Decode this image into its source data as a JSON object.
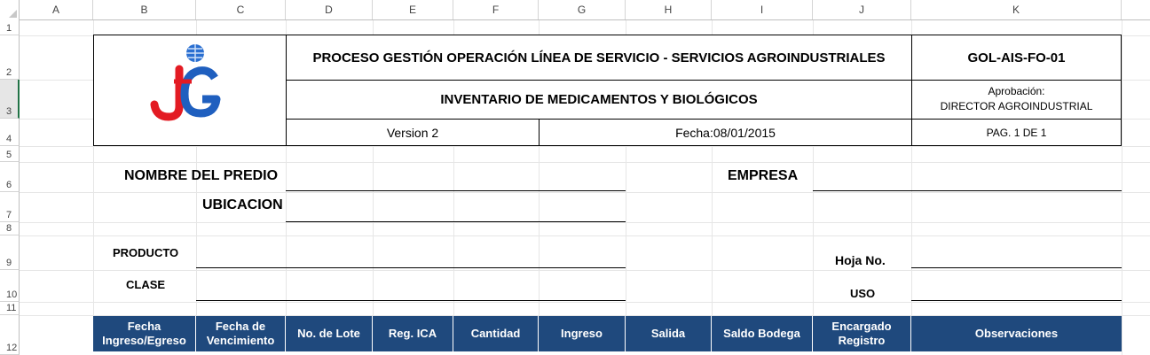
{
  "sheet": {
    "columns": [
      "A",
      "B",
      "C",
      "D",
      "E",
      "F",
      "G",
      "H",
      "I",
      "J",
      "K"
    ],
    "rows": [
      "1",
      "2",
      "3",
      "4",
      "5",
      "6",
      "7",
      "8",
      "9",
      "10",
      "11",
      "12"
    ],
    "selected_row": "3"
  },
  "header": {
    "process_title": "PROCESO GESTIÓN OPERACIÓN LÍNEA DE SERVICIO - SERVICIOS AGROINDUSTRIALES",
    "doc_code": "GOL-AIS-FO-01",
    "doc_title": "INVENTARIO DE MEDICAMENTOS Y BIOLÓGICOS",
    "approval_label": "Aprobación:",
    "approval_value": "DIRECTOR AGROINDUSTRIAL",
    "version": "Version 2",
    "date": "Fecha:08/01/2015",
    "page": "PAG. 1 DE 1",
    "logo_letters": "JG"
  },
  "form": {
    "nombre_predio": "NOMBRE DEL PREDIO",
    "empresa": "EMPRESA",
    "ubicacion": "UBICACION",
    "producto": "PRODUCTO",
    "clase": "CLASE",
    "hoja": "Hoja No.",
    "uso": "USO"
  },
  "table": {
    "headers": [
      "Fecha Ingreso/Egreso",
      "Fecha de Vencimiento",
      "No. de Lote",
      "Reg. ICA",
      "Cantidad",
      "Ingreso",
      "Salida",
      "Saldo Bodega",
      "Encargado Registro",
      "Observaciones"
    ],
    "header_color": "#1f497d"
  },
  "colors": {
    "excel_green": "#217346",
    "logo_red": "#e31b23",
    "logo_blue": "#1f5fbf"
  }
}
